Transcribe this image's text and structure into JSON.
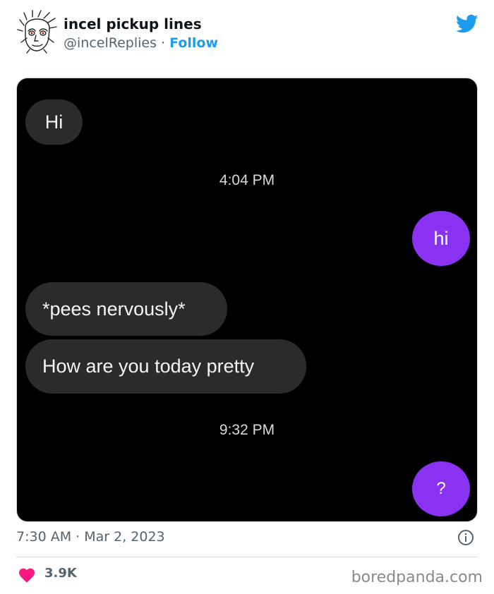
{
  "tweet": {
    "author_name": "incel pickup lines",
    "handle": "@incelReplies",
    "separator": "·",
    "follow_label": "Follow",
    "timestamp": "7:30 AM · Mar 2, 2023",
    "likes": "3.9K",
    "brand_icon": "twitter-bird-icon",
    "brand_color": "#1d9bf0",
    "like_color": "#f91880"
  },
  "chat": {
    "messages": [
      {
        "text": "Hi",
        "from": "them"
      },
      {
        "text": "4:04 PM",
        "kind": "time"
      },
      {
        "text": "hi",
        "from": "me"
      },
      {
        "text": "*pees nervously*",
        "from": "them"
      },
      {
        "text": "How are you today pretty",
        "from": "them"
      },
      {
        "text": "9:32 PM",
        "kind": "time"
      },
      {
        "text": "?",
        "from": "me"
      }
    ],
    "sent_color": "#8a32f2",
    "received_color": "#2b2b2d"
  },
  "watermark": "boredpanda.com"
}
